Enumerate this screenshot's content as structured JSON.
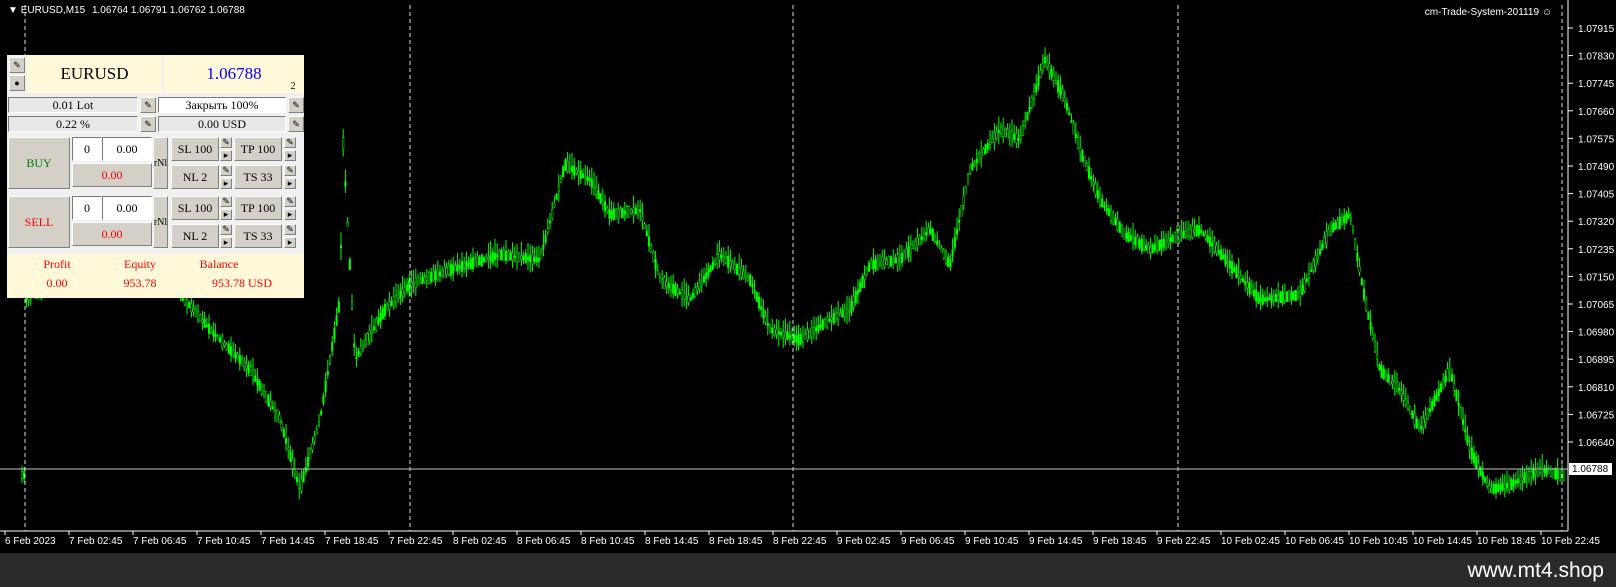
{
  "header": {
    "symbol_timeframe": "EURUSD,M15",
    "ohlc": "1.06764 1.06791 1.06762 1.06788",
    "indicator": "cm-Trade-System-201119"
  },
  "price_axis": {
    "labels": [
      "1.07915",
      "1.07830",
      "1.07745",
      "1.07660",
      "1.07575",
      "1.07490",
      "1.07405",
      "1.07320",
      "1.07235",
      "1.07150",
      "1.07065",
      "1.06980",
      "1.06895",
      "1.06810",
      "1.06725",
      "1.06640"
    ],
    "current_price": "1.06788"
  },
  "time_axis": {
    "labels": [
      "6 Feb 2023",
      "7 Feb 02:45",
      "7 Feb 06:45",
      "7 Feb 10:45",
      "7 Feb 14:45",
      "7 Feb 18:45",
      "7 Feb 22:45",
      "8 Feb 02:45",
      "8 Feb 06:45",
      "8 Feb 10:45",
      "8 Feb 14:45",
      "8 Feb 18:45",
      "8 Feb 22:45",
      "9 Feb 02:45",
      "9 Feb 06:45",
      "9 Feb 10:45",
      "9 Feb 14:45",
      "9 Feb 18:45",
      "9 Feb 22:45",
      "10 Feb 02:45",
      "10 Feb 06:45",
      "10 Feb 10:45",
      "10 Feb 14:45",
      "10 Feb 18:45",
      "10 Feb 22:45"
    ]
  },
  "panel": {
    "symbol": "EURUSD",
    "price": "1.06788",
    "spread": "2",
    "lot": "0.01 Lot",
    "close_pct": "Закрыть 100%",
    "risk": "0.22 %",
    "risk_usd": "0.00 USD",
    "buy": {
      "label": "BUY",
      "count": "0",
      "volume": "0.00",
      "profit": "0.00"
    },
    "sell": {
      "label": "SELL",
      "count": "0",
      "volume": "0.00",
      "profit": "0.00"
    },
    "mode_label": "rNl",
    "sl": "SL 100",
    "tp": "TP 100",
    "nl": "NL 2",
    "ts": "TS 33",
    "stats": {
      "profit_label": "Profit",
      "equity_label": "Equity",
      "balance_label": "Balance",
      "profit": "0.00",
      "equity": "953.78",
      "balance": "953.78 USD"
    },
    "colors": {
      "buy": "#008000",
      "sell": "#ff0000",
      "price": "#0000ff",
      "stats": "#ff0000"
    }
  },
  "footer": {
    "watermark": "www.mt4.shop"
  },
  "colors": {
    "candles": "#00ff00",
    "background": "#000000",
    "grid": "#ffffff"
  }
}
